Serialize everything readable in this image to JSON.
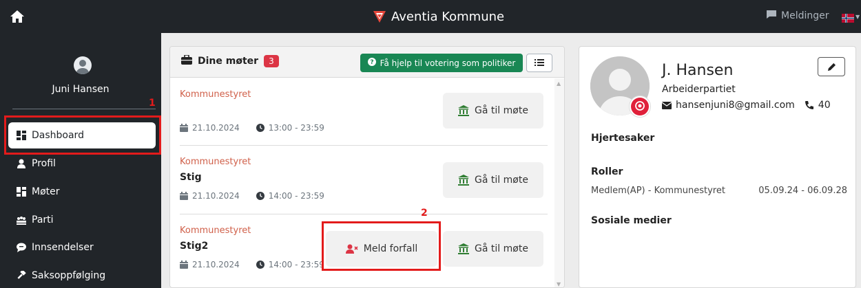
{
  "header": {
    "app_title": "Aventia Kommune",
    "messages_label": "Meldinger",
    "language": "Norsk"
  },
  "sidebar": {
    "user_name": "Juni Hansen",
    "items": [
      {
        "label": "Dashboard",
        "icon": "dashboard-icon",
        "active": true
      },
      {
        "label": "Profil",
        "icon": "user-icon",
        "active": false
      },
      {
        "label": "Møter",
        "icon": "meetings-icon",
        "active": false
      },
      {
        "label": "Parti",
        "icon": "party-icon",
        "active": false
      },
      {
        "label": "Innsendelser",
        "icon": "comment-icon",
        "active": false
      },
      {
        "label": "Saksoppfølging",
        "icon": "gavel-icon",
        "active": false
      }
    ]
  },
  "annotations": {
    "marker_1": "1",
    "marker_2": "2"
  },
  "meetings": {
    "title": "Dine møter",
    "count": "3",
    "help_button": "Få hjelp til votering som politiker",
    "goto_label": "Gå til møte",
    "absence_label": "Meld forfall",
    "items": [
      {
        "org": "Kommunestyret",
        "title": "",
        "date": "21.10.2024",
        "time": "13:00 - 23:59"
      },
      {
        "org": "Kommunestyret",
        "title": "Stig",
        "date": "21.10.2024",
        "time": "14:00 - 23:59"
      },
      {
        "org": "Kommunestyret",
        "title": "Stig2",
        "date": "21.10.2024",
        "time": "14:00 - 23:59"
      }
    ]
  },
  "profile": {
    "name": "J. Hansen",
    "party": "Arbeiderpartiet",
    "email": "hansenjuni8@gmail.com",
    "phone": "40",
    "section_heart": "Hjertesaker",
    "section_roles": "Roller",
    "role": "Medlem(AP) - Kommunestyret",
    "role_period": "05.09.24 - 06.09.28",
    "section_social": "Sosiale medier"
  },
  "colors": {
    "topbar": "#212529",
    "green": "#198754",
    "danger": "#dc3545",
    "annotation": "#e31b1b",
    "org_text": "#d0604a"
  }
}
